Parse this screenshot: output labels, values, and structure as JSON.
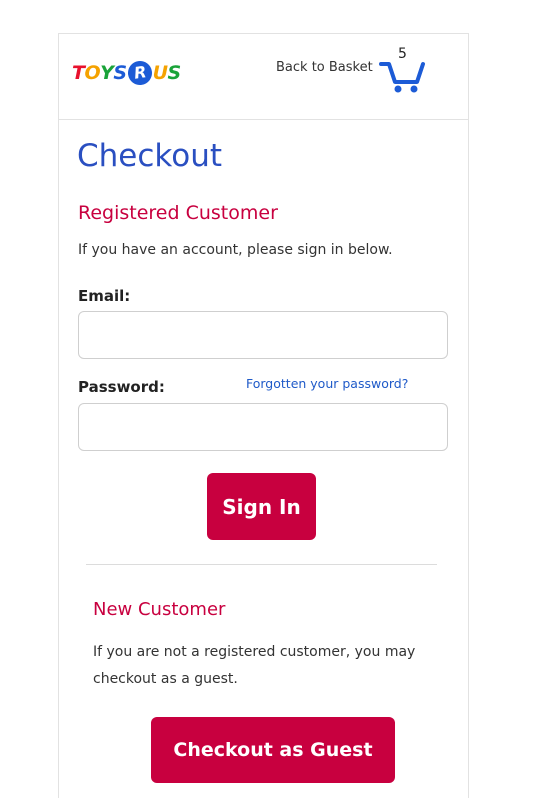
{
  "header": {
    "logo": [
      "T",
      "O",
      "Y",
      "S",
      "R",
      "U",
      "S"
    ],
    "basket_link": "Back to Basket",
    "basket_count": "5",
    "cart_icon": "shopping-cart-icon"
  },
  "page": {
    "title": "Checkout"
  },
  "registered": {
    "heading": "Registered Customer",
    "intro": "If you have an account, please sign in below.",
    "email_label": "Email:",
    "email_value": "",
    "password_label": "Password:",
    "password_value": "",
    "forgot_link": "Forgotten your password?",
    "sign_in_label": "Sign In"
  },
  "guest": {
    "heading": "New Customer",
    "text": "If you are not a registered customer, you may checkout as a guest.",
    "button_label": "Checkout as Guest"
  },
  "colors": {
    "accent": "#c8003f",
    "title_blue": "#2a4fc1",
    "link_blue": "#1f5ac8"
  }
}
